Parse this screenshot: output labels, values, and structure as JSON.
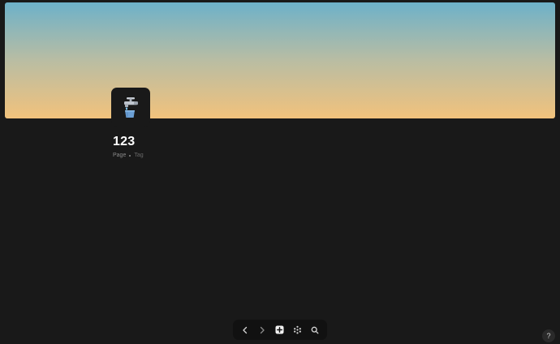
{
  "page": {
    "title": "123",
    "type_label": "Page",
    "tag_label": "Tag",
    "icon": "faucet-with-bucket-icon"
  },
  "cover": {
    "gradient_top": "#6db1c9",
    "gradient_bottom": "#f2c27c"
  },
  "toolbar": {
    "items": [
      {
        "icon": "chevron-left-icon"
      },
      {
        "icon": "chevron-right-icon"
      },
      {
        "icon": "plus-square-icon"
      },
      {
        "icon": "dots-grid-icon"
      },
      {
        "icon": "search-icon"
      }
    ]
  },
  "help": {
    "label": "?"
  },
  "colors": {
    "background": "#191919",
    "title": "#ffffff",
    "muted": "#8a8a8a"
  }
}
